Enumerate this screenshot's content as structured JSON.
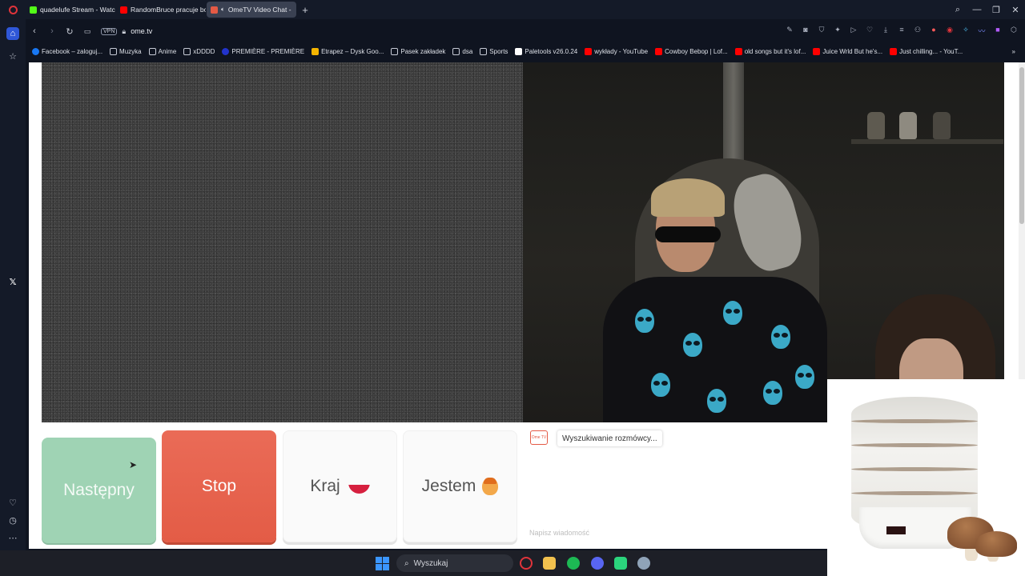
{
  "browser": {
    "tabs": [
      {
        "label": "quadelufe Stream - Watch",
        "fav_color": "#53fc18",
        "active": false
      },
      {
        "label": "RandomBruce pracuje bo",
        "fav_color": "#ff0000",
        "active": false
      },
      {
        "label": "OmeTV Video Chat -",
        "fav_color": "#e45a45",
        "active": true
      }
    ],
    "url": "ome.tv",
    "vpn_label": "VPN",
    "bookmarks": [
      {
        "label": "Facebook – zaloguj...",
        "icon": "facebook-icon",
        "color": "#1877f2"
      },
      {
        "label": "Muzyka",
        "icon": "folder-icon",
        "color": "#c7cbd6"
      },
      {
        "label": "Anime",
        "icon": "folder-icon",
        "color": "#c7cbd6"
      },
      {
        "label": "xDDDD",
        "icon": "folder-icon",
        "color": "#c7cbd6"
      },
      {
        "label": "PREMIÈRE - PREMIÈRE",
        "icon": "globe-icon",
        "color": "#2233cc"
      },
      {
        "label": "Etrapez – Dysk Goo...",
        "icon": "drive-icon",
        "color": "#f4b400"
      },
      {
        "label": "Pasek zakładek",
        "icon": "folder-icon",
        "color": "#c7cbd6"
      },
      {
        "label": "dsa",
        "icon": "folder-icon",
        "color": "#c7cbd6"
      },
      {
        "label": "Sports",
        "icon": "folder-icon",
        "color": "#c7cbd6"
      },
      {
        "label": "Paletools v26.0.24",
        "icon": "page-icon",
        "color": "#ffffff"
      },
      {
        "label": "wykłady - YouTube",
        "icon": "youtube-icon",
        "color": "#ff0000"
      },
      {
        "label": "Cowboy Bebop | Lof...",
        "icon": "youtube-icon",
        "color": "#ff0000"
      },
      {
        "label": "old songs but it's lof...",
        "icon": "youtube-icon",
        "color": "#ff0000"
      },
      {
        "label": "Juice Wrld But he's...",
        "icon": "youtube-icon",
        "color": "#ff0000"
      },
      {
        "label": "Just chilling... - YouT...",
        "icon": "youtube-icon",
        "color": "#ff0000"
      }
    ]
  },
  "ometv": {
    "buttons": {
      "next": "Następny",
      "stop": "Stop",
      "country": "Kraj",
      "gender": "Jestem"
    },
    "chat": {
      "logo_text": "Ome TV",
      "status": "Wyszukiwanie rozmówcy...",
      "input_placeholder": "Napisz wiadomość"
    }
  },
  "taskbar": {
    "search_label": "Wyszukaj"
  },
  "colors": {
    "accent_next": "#9fd3b4",
    "accent_stop": "#e35c46",
    "browser_bg": "#141a28"
  }
}
